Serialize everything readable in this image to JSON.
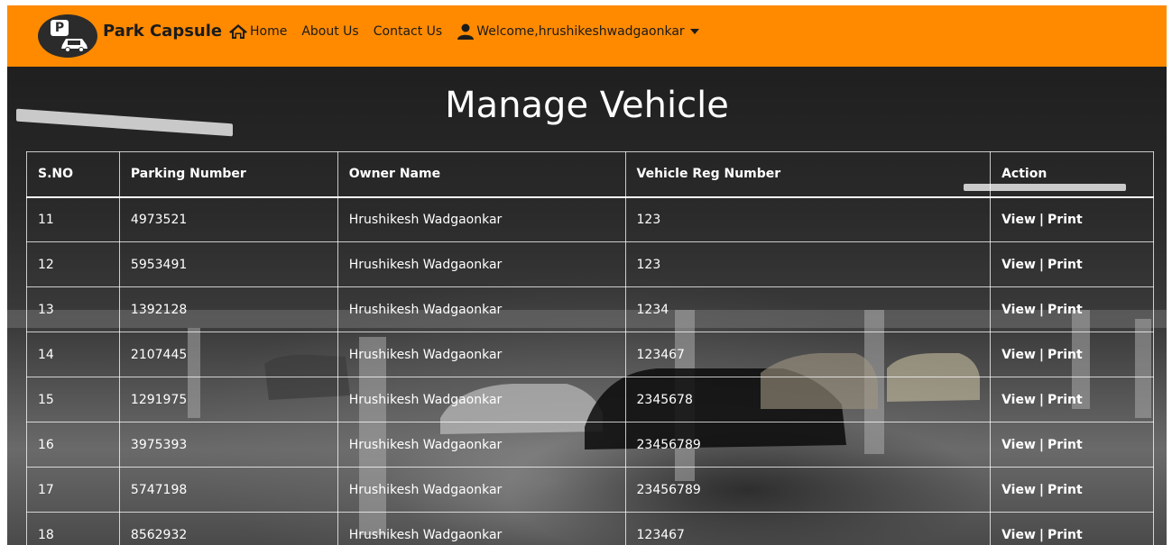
{
  "nav": {
    "logo_letter": "P",
    "brand": "Park Capsule",
    "links": {
      "home": "Home",
      "about": "About Us",
      "contact": "Contact Us",
      "user": "Welcome,hrushikeshwadgaonkar"
    },
    "icons": {
      "home": "home-icon",
      "user": "user-icon",
      "caret": "caret-down-icon"
    },
    "colors": {
      "navbar": "#ff8a00",
      "text": "#1b1b1b"
    }
  },
  "page": {
    "title": "Manage Vehicle"
  },
  "table": {
    "headers": {
      "sno": "S.NO",
      "parking_number": "Parking Number",
      "owner_name": "Owner Name",
      "vehicle_reg_number": "Vehicle Reg Number",
      "action": "Action"
    },
    "rows": [
      {
        "sno": "11",
        "parking_number": "4973521",
        "owner_name": "Hrushikesh Wadgaonkar",
        "vehicle_reg_number": "123",
        "view": "View",
        "separator": "|",
        "print": "Print"
      },
      {
        "sno": "12",
        "parking_number": "5953491",
        "owner_name": "Hrushikesh Wadgaonkar",
        "vehicle_reg_number": "123",
        "view": "View",
        "separator": "|",
        "print": "Print"
      },
      {
        "sno": "13",
        "parking_number": "1392128",
        "owner_name": "Hrushikesh Wadgaonkar",
        "vehicle_reg_number": "1234",
        "view": "View",
        "separator": "|",
        "print": "Print"
      },
      {
        "sno": "14",
        "parking_number": "2107445",
        "owner_name": "Hrushikesh Wadgaonkar",
        "vehicle_reg_number": "123467",
        "view": "View",
        "separator": "|",
        "print": "Print"
      },
      {
        "sno": "15",
        "parking_number": "1291975",
        "owner_name": "Hrushikesh Wadgaonkar",
        "vehicle_reg_number": "2345678",
        "view": "View",
        "separator": "|",
        "print": "Print"
      },
      {
        "sno": "16",
        "parking_number": "3975393",
        "owner_name": "Hrushikesh Wadgaonkar",
        "vehicle_reg_number": "23456789",
        "view": "View",
        "separator": "|",
        "print": "Print"
      },
      {
        "sno": "17",
        "parking_number": "5747198",
        "owner_name": "Hrushikesh Wadgaonkar",
        "vehicle_reg_number": "23456789",
        "view": "View",
        "separator": "|",
        "print": "Print"
      },
      {
        "sno": "18",
        "parking_number": "8562932",
        "owner_name": "Hrushikesh Wadgaonkar",
        "vehicle_reg_number": "123467",
        "view": "View",
        "separator": "|",
        "print": "Print"
      }
    ]
  }
}
